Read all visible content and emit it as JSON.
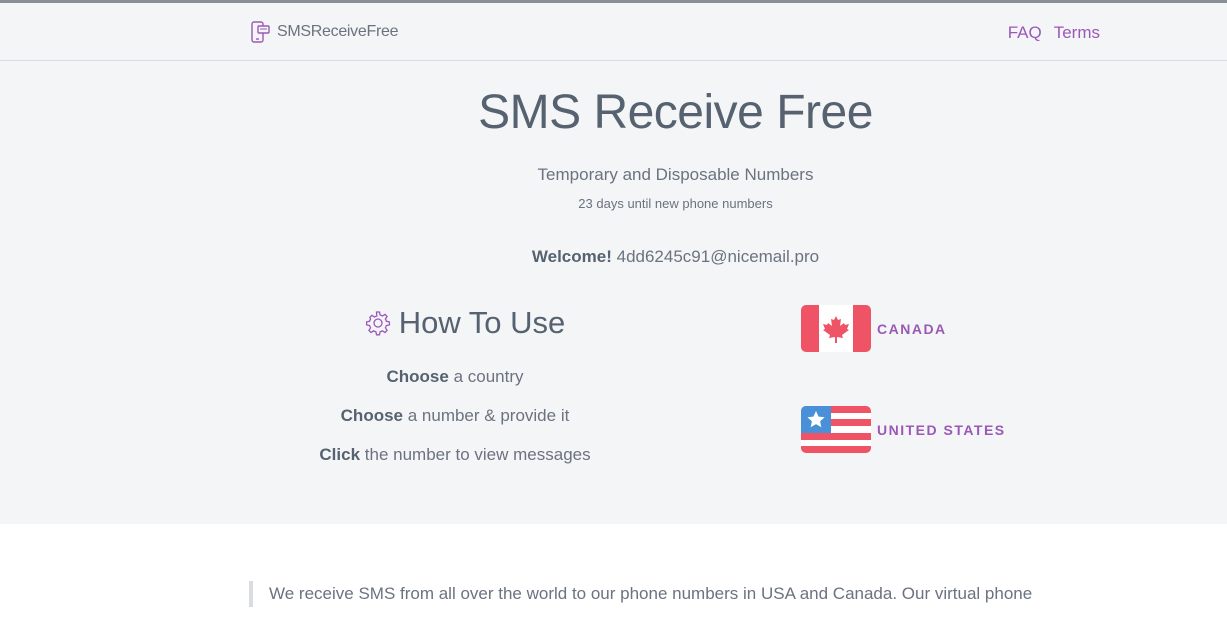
{
  "navbar": {
    "brand": "SMSReceiveFree",
    "links": [
      "FAQ",
      "Terms"
    ]
  },
  "hero": {
    "title": "SMS Receive Free",
    "subtitle": "Temporary and Disposable Numbers",
    "countdown": "23 days until new phone numbers",
    "welcome_label": "Welcome!",
    "welcome_email": "4dd6245c91@nicemail.pro"
  },
  "howto": {
    "title": "How To Use",
    "steps": [
      {
        "bold": "Choose",
        "rest": "a country"
      },
      {
        "bold": "Choose",
        "rest": "a number & provide it"
      },
      {
        "bold": "Click",
        "rest": "the number to view messages"
      }
    ]
  },
  "countries": [
    {
      "name": "CANADA"
    },
    {
      "name": "UNITED STATES"
    }
  ],
  "about": {
    "text": "We receive SMS from all over the world to our phone numbers in USA and Canada. Our virtual phone"
  },
  "colors": {
    "accent": "#9b59b6",
    "flag_red": "#ef5366",
    "flag_blue": "#4a90d9",
    "text": "#566270",
    "hero_bg": "#f4f5f7"
  },
  "icons": {
    "brand": "phone-message-icon",
    "howto": "gear-icon"
  }
}
